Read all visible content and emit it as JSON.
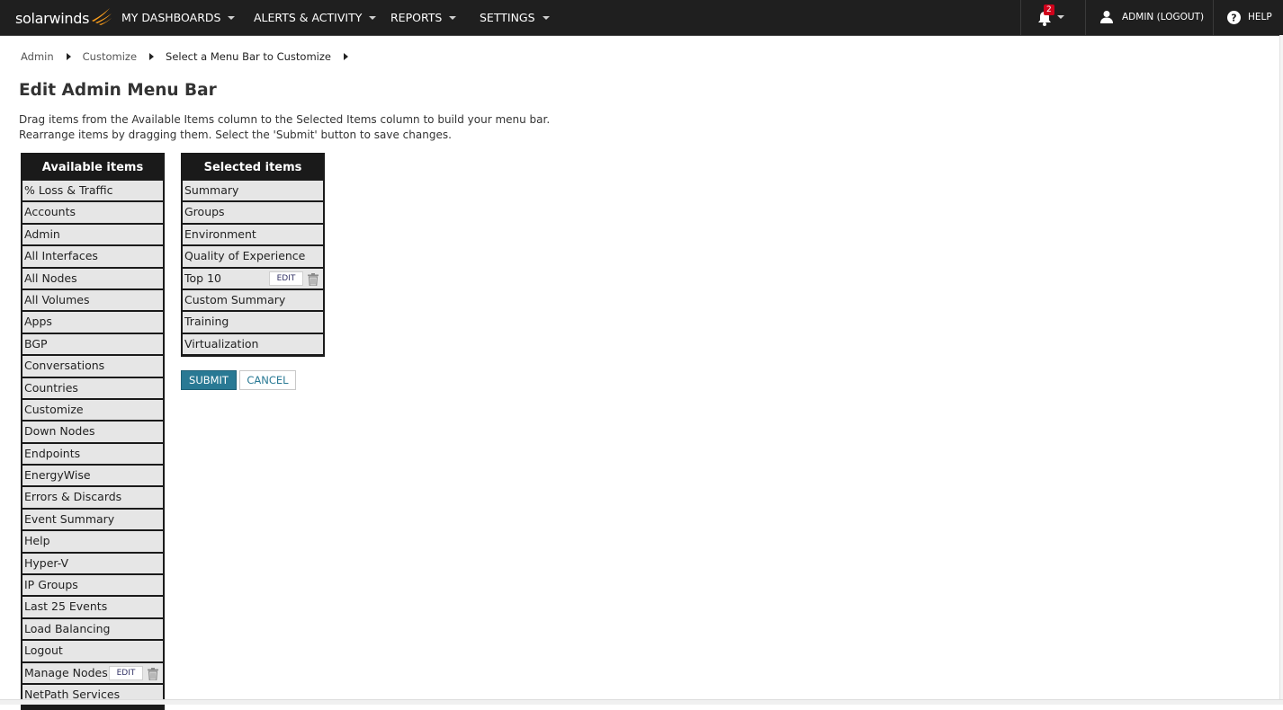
{
  "header": {
    "logo_text": "solarwinds",
    "nav": [
      {
        "label": "MY DASHBOARDS"
      },
      {
        "label": "ALERTS & ACTIVITY"
      },
      {
        "label": "REPORTS"
      },
      {
        "label": "SETTINGS"
      }
    ],
    "notification_count": "2",
    "user_label": "ADMIN  (LOGOUT)",
    "help_label": "HELP",
    "brand_color": "#f99d1c",
    "badge_color": "#d0021b"
  },
  "breadcrumb": {
    "items": [
      "Admin",
      "Customize",
      "Select a Menu Bar to Customize"
    ]
  },
  "page": {
    "title": "Edit Admin Menu Bar",
    "instructions_line1": "Drag items from the Available Items column to the Selected Items column to build your menu bar.",
    "instructions_line2": "Rearrange items by dragging them. Select the 'Submit' button to save changes."
  },
  "available": {
    "header": "Available items",
    "items": [
      "% Loss & Traffic",
      "Accounts",
      "Admin",
      "All Interfaces",
      "All Nodes",
      "All Volumes",
      "Apps",
      "BGP",
      "Conversations",
      "Countries",
      "Customize",
      "Down Nodes",
      "Endpoints",
      "EnergyWise",
      "Errors & Discards",
      "Event Summary",
      "Help",
      "Hyper-V",
      "IP Groups",
      "Last 25 Events",
      "Load Balancing",
      "Logout",
      "Manage Nodes",
      "NetPath Services"
    ]
  },
  "selected": {
    "header": "Selected items",
    "items": [
      "Summary",
      "Groups",
      "Environment",
      "Quality of Experience",
      "Top 10",
      "Custom Summary",
      "Training",
      "Virtualization"
    ]
  },
  "edit_label": "EDIT",
  "buttons": {
    "submit": "SUBMIT",
    "cancel": "CANCEL",
    "accent_color": "#297994"
  }
}
